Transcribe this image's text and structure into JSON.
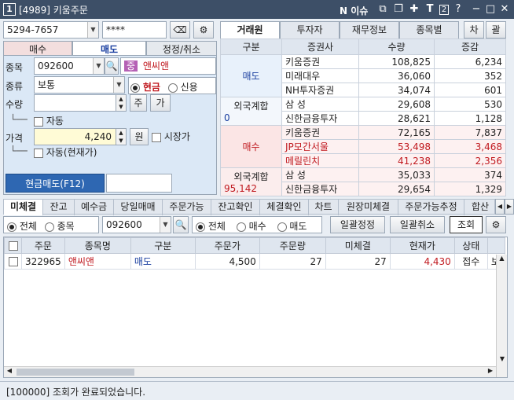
{
  "window": {
    "screen_no": "[4989]",
    "title": "키움주문",
    "badge_num": "1",
    "issue_label": "N 이슈",
    "icons": [
      "restore-icon",
      "copy-icon",
      "pin-icon",
      "font-icon",
      "help-num-icon",
      "help-icon",
      "minimize-icon",
      "maximize-icon",
      "close-icon"
    ]
  },
  "account": {
    "number": "5294-7657",
    "password": "****"
  },
  "order_tabs": [
    "매수",
    "매도",
    "정정/취소"
  ],
  "form": {
    "code_label": "종목",
    "code": "092600",
    "stock_badge": "중",
    "stock_name": "앤씨앤",
    "type_label": "종류",
    "type_value": "보통",
    "radio_cash": "현금",
    "radio_credit": "신용",
    "qty_label": "수량",
    "qty_value": "",
    "btn_stock": "주",
    "btn_avail": "가",
    "auto_label": "자동",
    "price_label": "가격",
    "price_value": "4,240",
    "btn_won": "원",
    "market_price_label": "시장가",
    "auto_current_label": "자동(현재가)",
    "submit_label": "현금매도(F12)"
  },
  "broker_tabs": [
    "거래원",
    "투자자",
    "재무정보",
    "종목별",
    "차",
    "괄"
  ],
  "broker_table": {
    "headers": [
      "구분",
      "증권사",
      "수량",
      "증감"
    ],
    "sell_label": "매도",
    "sell_rows": [
      {
        "name": "키움증권",
        "qty": "108,825",
        "diff": "6,234"
      },
      {
        "name": "미래대우",
        "qty": "36,060",
        "diff": "352"
      },
      {
        "name": "NH투자증권",
        "qty": "34,074",
        "diff": "601"
      },
      {
        "name": "삼    성",
        "qty": "29,608",
        "diff": "530"
      },
      {
        "name": "신한금융투자",
        "qty": "28,621",
        "diff": "1,128"
      }
    ],
    "foreign_label": "외국계합",
    "sell_foreign_value": "0",
    "buy_label": "매수",
    "buy_rows": [
      {
        "name": "키움증권",
        "qty": "72,165",
        "diff": "7,837"
      },
      {
        "name": "JP모간서울",
        "qty": "53,498",
        "diff": "3,468"
      },
      {
        "name": "메릴린치",
        "qty": "41,238",
        "diff": "2,356"
      },
      {
        "name": "삼    성",
        "qty": "35,033",
        "diff": "374"
      },
      {
        "name": "신한금융투자",
        "qty": "29,654",
        "diff": "1,329"
      }
    ],
    "buy_foreign_value": "95,142"
  },
  "bottom_tabs": [
    "미체결",
    "잔고",
    "예수금",
    "당일매매",
    "주문가능",
    "잔고확인",
    "체결확인",
    "차트",
    "원장미체결",
    "주문가능추정",
    "합산"
  ],
  "filter": {
    "r_all": "전체",
    "r_stock": "종목",
    "code": "092600",
    "r_all2": "전체",
    "r_buy": "매수",
    "r_sell": "매도",
    "btn_bulk_edit": "일괄정정",
    "btn_bulk_cancel": "일괄취소",
    "btn_query": "조회"
  },
  "grid": {
    "headers": [
      "주문",
      "종목명",
      "구분",
      "주문가",
      "주문량",
      "미체결",
      "현재가",
      "상태"
    ],
    "rows": [
      {
        "order": "322965",
        "name": "앤씨앤",
        "side": "매도",
        "price": "4,500",
        "qty": "27",
        "unfilled": "27",
        "current": "4,430",
        "status": "접수",
        "extra": "보"
      }
    ]
  },
  "status_message": "[100000] 조회가 완료되었습니다."
}
